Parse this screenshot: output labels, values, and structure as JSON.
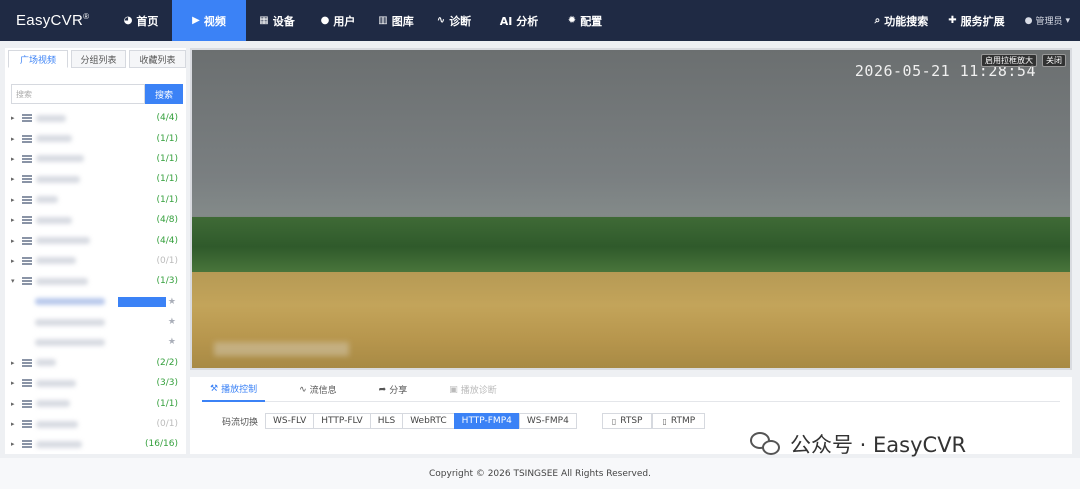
{
  "brand": {
    "name": "EasyCVR",
    "mark": "®"
  },
  "nav": {
    "items": [
      {
        "label": "首页",
        "icon": "dashboard-icon",
        "glyph": "◕"
      },
      {
        "label": "视频",
        "icon": "play-icon",
        "glyph": "▶",
        "active": true
      },
      {
        "label": "设备",
        "icon": "device-icon",
        "glyph": "▦"
      },
      {
        "label": "用户",
        "icon": "user-icon",
        "glyph": "●"
      },
      {
        "label": "图库",
        "icon": "gallery-icon",
        "glyph": "▥"
      },
      {
        "label": "诊断",
        "icon": "pulse-icon",
        "glyph": "∿"
      },
      {
        "label": "AI 分析",
        "icon": "ai-icon",
        "glyph": ""
      },
      {
        "label": "配置",
        "icon": "gear-icon",
        "glyph": "✹"
      }
    ],
    "right": [
      {
        "label": "功能搜索",
        "icon": "search-icon",
        "glyph": "⌕"
      },
      {
        "label": "服务扩展",
        "icon": "puzzle-icon",
        "glyph": "✚"
      }
    ],
    "user": {
      "label": "管理员",
      "icon": "user-icon",
      "caret": "▾"
    }
  },
  "sidebar": {
    "tabs": [
      "广场视频",
      "分组列表",
      "收藏列表"
    ],
    "search_placeholder": "搜索",
    "search_button": "搜索",
    "groups_top": [
      {
        "count": "(4/4)",
        "blur_w": 30
      },
      {
        "count": "(1/1)",
        "blur_w": 36
      },
      {
        "count": "(1/1)",
        "blur_w": 48
      },
      {
        "count": "(1/1)",
        "blur_w": 44
      },
      {
        "count": "(1/1)",
        "blur_w": 22
      },
      {
        "count": "(4/8)",
        "blur_w": 36
      },
      {
        "count": "(4/4)",
        "blur_w": 54
      },
      {
        "count": "(0/1)",
        "blur_w": 40,
        "zero": true
      }
    ],
    "expanded_group": {
      "count": "(1/3)",
      "blur_w": 52
    },
    "cameras": 3,
    "groups_bottom": [
      {
        "count": "(2/2)",
        "blur_w": 20
      },
      {
        "count": "(3/3)",
        "blur_w": 40
      },
      {
        "count": "(1/1)",
        "blur_w": 34
      },
      {
        "count": "(0/1)",
        "blur_w": 42,
        "zero": true
      },
      {
        "count": "(16/16)",
        "blur_w": 46
      }
    ]
  },
  "player": {
    "timestamp": "2026-05-21 11:28:54",
    "zoom_button": "启用拉框放大",
    "close_button": "关闭"
  },
  "controls": {
    "tabs": [
      {
        "label": "播放控制",
        "icon": "tools-icon",
        "glyph": "⚒",
        "active": true
      },
      {
        "label": "流信息",
        "icon": "pulse-icon",
        "glyph": "∿"
      },
      {
        "label": "分享",
        "icon": "share-icon",
        "glyph": "➦"
      },
      {
        "label": "播放诊断",
        "icon": "diagnose-icon",
        "glyph": "▣",
        "disabled": true
      }
    ],
    "stream_label": "码流切换",
    "streams": [
      "WS-FLV",
      "HTTP-FLV",
      "HLS",
      "WebRTC",
      "HTTP-FMP4",
      "WS-FMP4"
    ],
    "active_stream": "HTTP-FMP4",
    "protocols": [
      "RTSP",
      "RTMP"
    ]
  },
  "watermark": "公众号 · EasyCVR",
  "footer": "Copyright © 2026 TSINGSEE All Rights Reserved."
}
